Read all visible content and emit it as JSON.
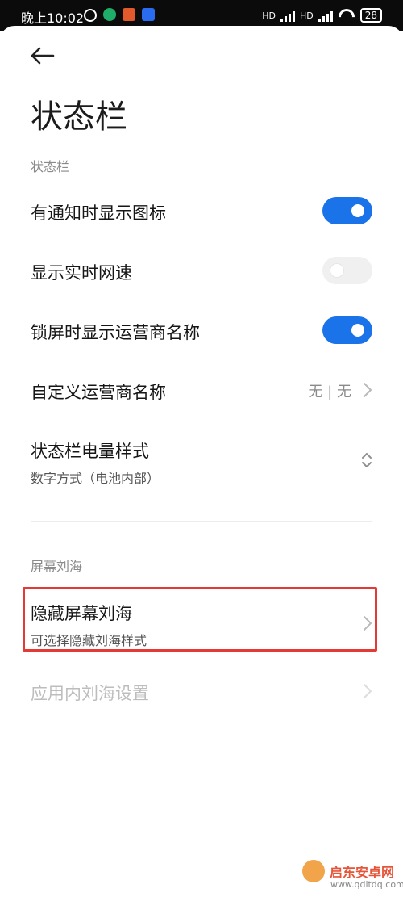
{
  "status_bar": {
    "time": "晚上10:02",
    "battery": "28",
    "network_labels": [
      "HD",
      "HD"
    ]
  },
  "page": {
    "title": "状态栏"
  },
  "sections": [
    {
      "header": "状态栏",
      "items": [
        {
          "title": "有通知时显示图标",
          "toggle": true
        },
        {
          "title": "显示实时网速",
          "toggle": false
        },
        {
          "title": "锁屏时显示运营商名称",
          "toggle": true
        },
        {
          "title": "自定义运营商名称",
          "value": "无 | 无"
        },
        {
          "title": "状态栏电量样式",
          "subtitle": "数字方式（电池内部）"
        }
      ]
    },
    {
      "header": "屏幕刘海",
      "items": [
        {
          "title": "隐藏屏幕刘海",
          "subtitle": "可选择隐藏刘海样式"
        },
        {
          "title": "应用内刘海设置",
          "disabled": true
        }
      ]
    }
  ],
  "colors": {
    "accent": "#1a73e8",
    "highlight_border": "#e53935",
    "watermark": "#e6553a"
  },
  "watermark": {
    "brand": "启东安卓网",
    "url": "www.qdltdq.com"
  }
}
